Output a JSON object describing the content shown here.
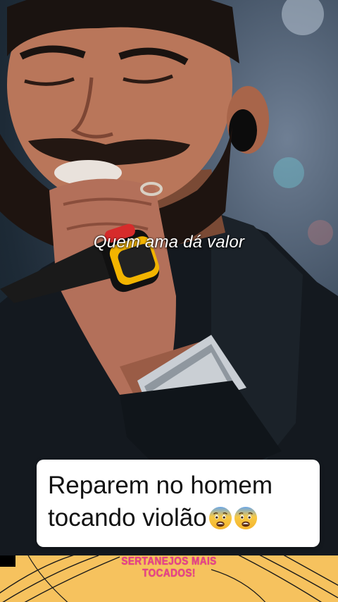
{
  "video": {
    "subtitle": "Quem ama dá valor"
  },
  "caption": {
    "line1": "Reparem no homem",
    "line2": "tocando violão",
    "emojis": [
      "fearful-face",
      "fearful-face"
    ]
  },
  "banner": {
    "line1": "SERTANEJOS MAIS",
    "line2": "TOCADOS!",
    "background_color": "#f6c25e",
    "text_color": "#e8408c"
  }
}
